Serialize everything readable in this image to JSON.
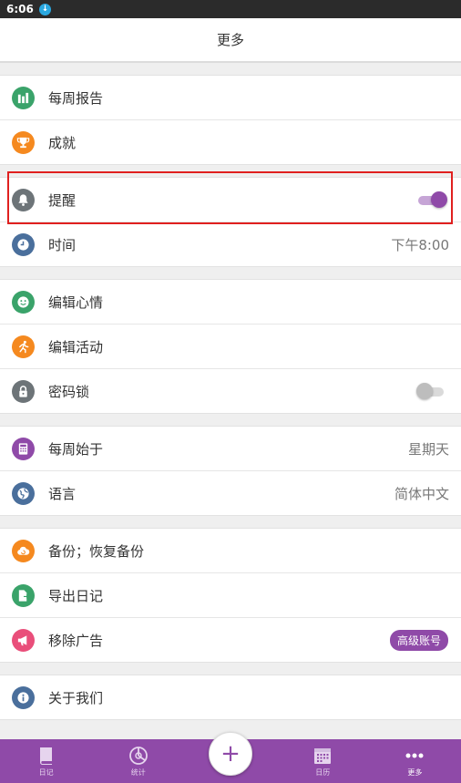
{
  "status": {
    "time": "6:06"
  },
  "header": {
    "title": "更多"
  },
  "groups": [
    {
      "items": [
        {
          "label": "每周报告",
          "icon": "bar-chart-icon",
          "color": "#3aa36a"
        },
        {
          "label": "成就",
          "icon": "trophy-icon",
          "color": "#f5891f"
        }
      ]
    },
    {
      "items": [
        {
          "label": "提醒",
          "icon": "bell-icon",
          "color": "#6d7478",
          "toggle": true
        },
        {
          "label": "时间",
          "icon": "clock-icon",
          "color": "#4a6f9c",
          "value": "下午8:00"
        }
      ]
    },
    {
      "items": [
        {
          "label": "编辑心情",
          "icon": "smiley-icon",
          "color": "#3aa36a"
        },
        {
          "label": "编辑活动",
          "icon": "running-icon",
          "color": "#f5891f"
        },
        {
          "label": "密码锁",
          "icon": "lock-icon",
          "color": "#6d7478",
          "toggle": false
        }
      ]
    },
    {
      "items": [
        {
          "label": "每周始于",
          "icon": "calculator-icon",
          "color": "#8f4aa8",
          "value": "星期天"
        },
        {
          "label": "语言",
          "icon": "globe-icon",
          "color": "#4a6f9c",
          "value": "简体中文"
        }
      ]
    },
    {
      "items": [
        {
          "label": "备份；恢复备份",
          "icon": "cloud-icon",
          "color": "#f5891f"
        },
        {
          "label": "导出日记",
          "icon": "export-icon",
          "color": "#3aa36a"
        },
        {
          "label": "移除广告",
          "icon": "megaphone-icon",
          "color": "#e94e7a",
          "badge": "高级账号"
        }
      ]
    },
    {
      "items": [
        {
          "label": "关于我们",
          "icon": "info-icon",
          "color": "#4a6f9c"
        }
      ]
    }
  ],
  "tabs": [
    {
      "label": "日记",
      "icon": "book-icon"
    },
    {
      "label": "统计",
      "icon": "pie-chart-icon"
    },
    {
      "label": "",
      "icon": "plus-icon"
    },
    {
      "label": "日历",
      "icon": "calendar-icon"
    },
    {
      "label": "更多",
      "icon": "more-icon"
    }
  ],
  "colors": {
    "accent": "#8f4aa8",
    "highlight": "#e0201f"
  }
}
